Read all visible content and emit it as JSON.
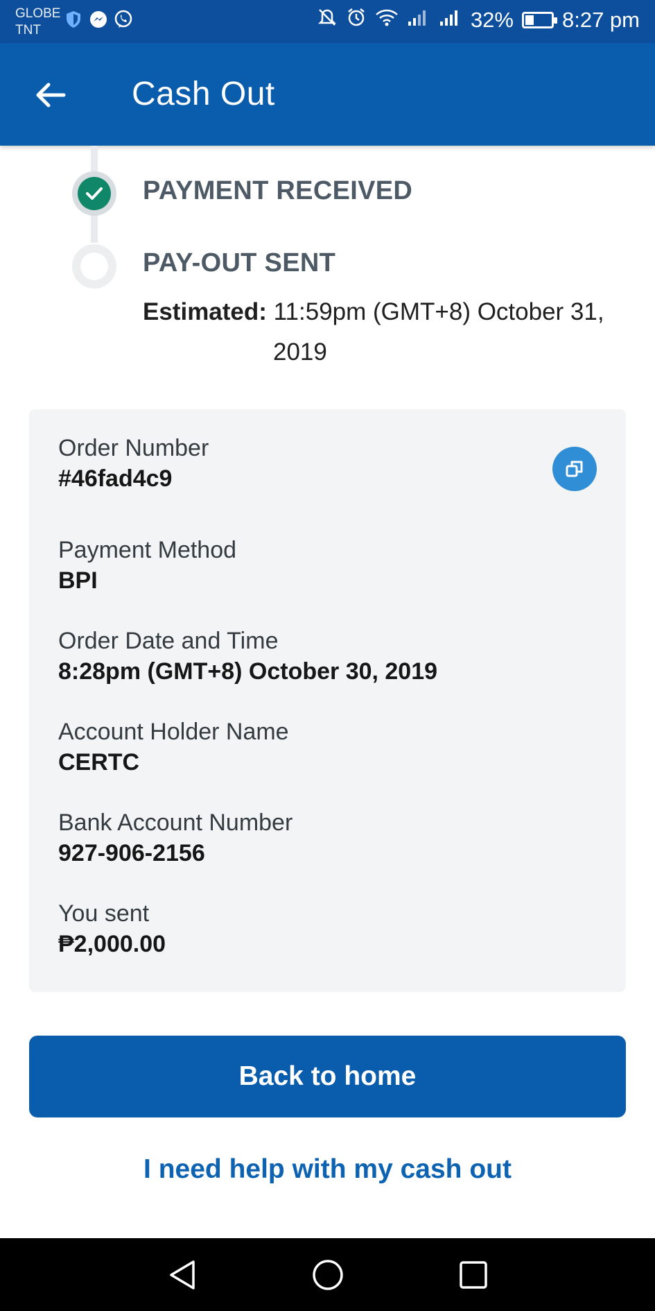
{
  "status_bar": {
    "carrier_line1": "GLOBE",
    "carrier_line2": "TNT",
    "battery_percent": "32%",
    "battery_level": 0.32,
    "time": "8:27 pm"
  },
  "header": {
    "title": "Cash Out"
  },
  "progress": {
    "steps": [
      {
        "label": "PAYMENT RECEIVED",
        "status": "done"
      },
      {
        "label": "PAY-OUT SENT",
        "status": "pending"
      }
    ],
    "estimated_label": "Estimated:",
    "estimated_line1": "11:59pm (GMT+8) October 31,",
    "estimated_line2": "2019"
  },
  "details": {
    "fields": [
      {
        "label": "Order Number",
        "value": "#46fad4c9"
      },
      {
        "label": "Payment Method",
        "value": "BPI"
      },
      {
        "label": "Order Date and Time",
        "value": "8:28pm (GMT+8) October 30, 2019"
      },
      {
        "label": "Account Holder Name",
        "value": "CERTC"
      },
      {
        "label": "Bank Account Number",
        "value": "927-906-2156"
      },
      {
        "label": "You sent",
        "value": "₱2,000.00"
      }
    ]
  },
  "actions": {
    "primary_label": "Back to home",
    "help_label": "I need help with my cash out"
  },
  "colors": {
    "brand_blue": "#0a5cad",
    "success_green": "#11876a",
    "copy_blue": "#2f8ed6"
  }
}
